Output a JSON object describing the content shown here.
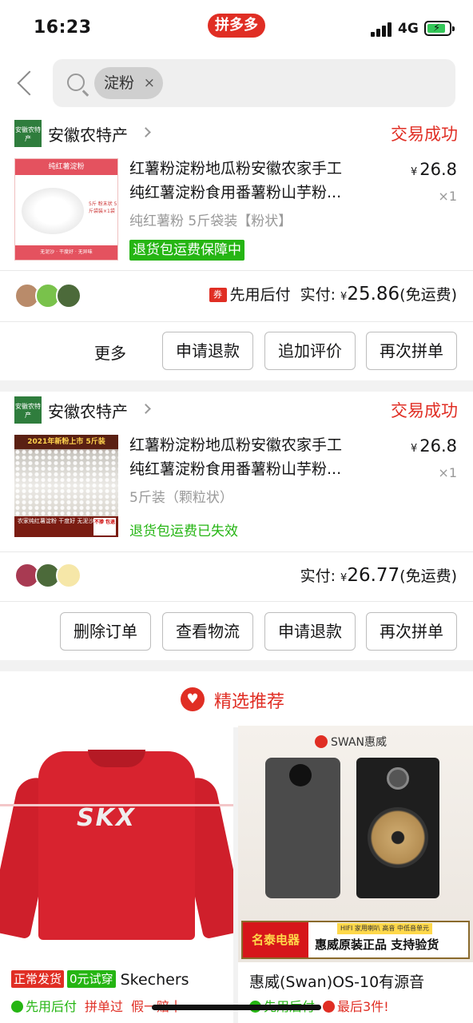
{
  "status_bar": {
    "time": "16:23",
    "app_badge": "拼多多",
    "network": "4G"
  },
  "search": {
    "chip_text": "淀粉",
    "chip_close": "×"
  },
  "orders": [
    {
      "shop_name": "安徽农特产",
      "shop_logo_text": "安徽农特产",
      "status": "交易成功",
      "thumb": {
        "band": "纯红薯淀粉",
        "tag": "5斤 粉末状 5斤袋装×1袋",
        "foot": "无泥沙 · 干度好 · 无异味"
      },
      "title_line1": "红薯粉淀粉地瓜粉安徽农家手工",
      "title_line2": "纯红薯淀粉食用番薯粉山芋粉...",
      "currency": "¥",
      "price": "26.8",
      "qty": "×1",
      "spec": "纯红薯粉 5斤袋装【粉状】",
      "service": "退货包运费保障中",
      "coupon": "券",
      "pay_method": "先用后付",
      "paid_label": "实付:",
      "paid_amount": "25.86",
      "shipping": "(免运费)",
      "more_label": "更多",
      "buttons": [
        "申请退款",
        "追加评价",
        "再次拼单"
      ]
    },
    {
      "shop_name": "安徽农特产",
      "shop_logo_text": "安徽农特产",
      "status": "交易成功",
      "thumb": {
        "top": "2021年新粉上市 5斤装",
        "bottom": "农家纯红薯淀粉 干度好 无泥沙 不酸臭",
        "stamp": "不掺 包退"
      },
      "title_line1": "红薯粉淀粉地瓜粉安徽农家手工",
      "title_line2": "纯红薯淀粉食用番薯粉山芋粉...",
      "currency": "¥",
      "price": "26.8",
      "qty": "×1",
      "spec": "5斤装（颗粒状）",
      "service": "退货包运费已失效",
      "paid_label": "实付:",
      "paid_amount": "26.77",
      "shipping": "(免运费)",
      "buttons": [
        "删除订单",
        "查看物流",
        "申请退款",
        "再次拼单"
      ]
    }
  ],
  "recommend": {
    "title": "精选推荐"
  },
  "products": [
    {
      "image_text": "SKX",
      "tag1": "正常发货",
      "tag2": "0元试穿",
      "brand": "Skechers",
      "meta_green": "先用后付",
      "meta_red": "拼单过",
      "meta_tail": "假一赔十"
    },
    {
      "logo_text": "SWAN惠威",
      "banner_red": "名泰电器",
      "banner_sub": "HIFI 家用喇叭 高音 中低音单元",
      "banner_main": "惠威原装正品 支持验货",
      "title": "惠威(Swan)OS-10有源音",
      "meta_green": "先用后付",
      "meta_red": "最后3件!"
    }
  ],
  "colors": {
    "brand_red": "#e02e24",
    "green": "#25b513",
    "text": "#151516",
    "muted": "#999999"
  }
}
